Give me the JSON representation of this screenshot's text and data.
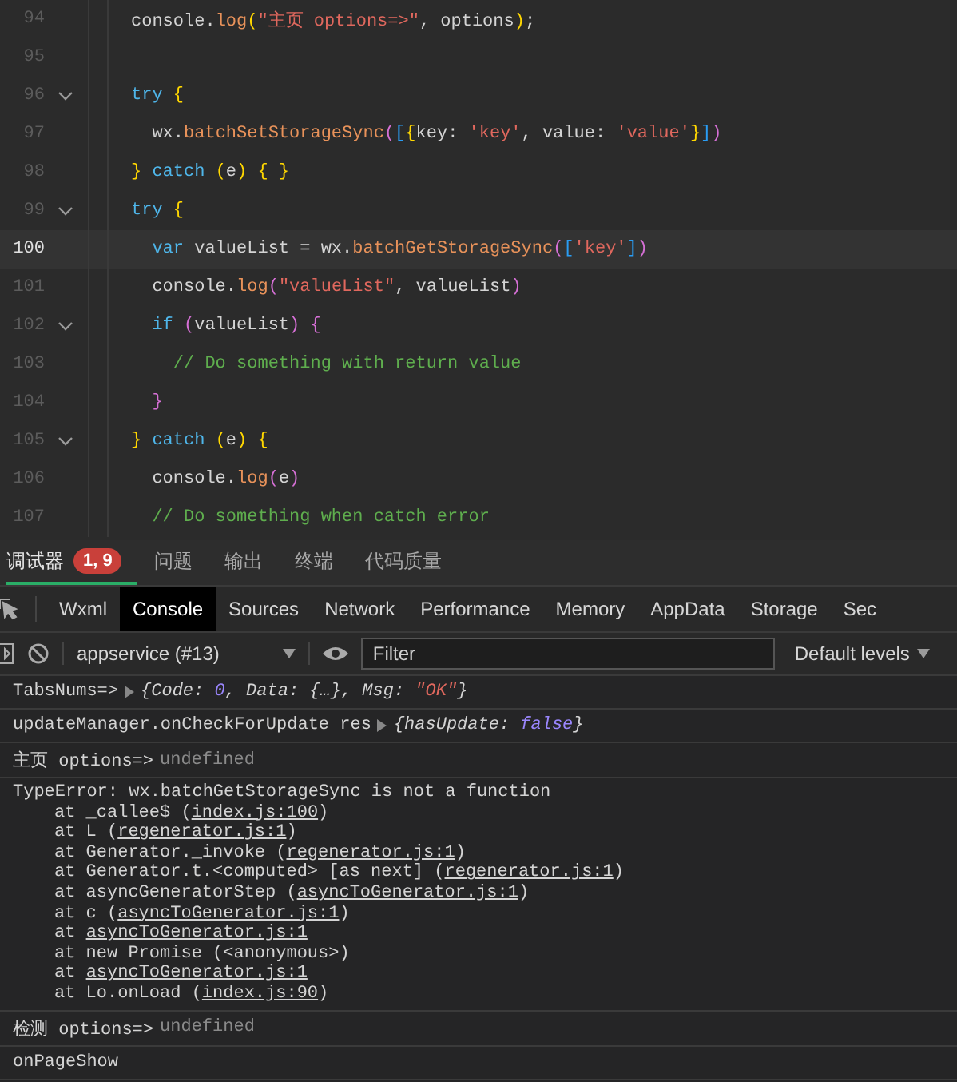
{
  "editor": {
    "lines": [
      {
        "number": "94",
        "fold": false,
        "current": false,
        "tokens": [
          {
            "text": "console.",
            "kind": "plain"
          },
          {
            "text": "log",
            "kind": "fn"
          },
          {
            "text": "(",
            "kind": "brace"
          },
          {
            "text": "\"主页 options=>\"",
            "kind": "str"
          },
          {
            "text": ", options",
            "kind": "plain"
          },
          {
            "text": ")",
            "kind": "brace"
          },
          {
            "text": ";",
            "kind": "plain"
          }
        ]
      },
      {
        "number": "95",
        "fold": false,
        "current": false
      },
      {
        "number": "96",
        "fold": true,
        "current": false,
        "tokens": [
          {
            "text": "try",
            "kind": "kw"
          },
          {
            "text": " {",
            "kind": "brace"
          }
        ]
      },
      {
        "number": "97",
        "fold": false,
        "current": false,
        "tokens": [
          {
            "text": "  wx.",
            "kind": "plain"
          },
          {
            "text": "batchSetStorageSync",
            "kind": "fn"
          },
          {
            "text": "(",
            "kind": "paren"
          },
          {
            "text": "[",
            "kind": "bracket"
          },
          {
            "text": "{",
            "kind": "brace"
          },
          {
            "text": "key: ",
            "kind": "plain"
          },
          {
            "text": "'key'",
            "kind": "str"
          },
          {
            "text": ", value: ",
            "kind": "plain"
          },
          {
            "text": "'value'",
            "kind": "str"
          },
          {
            "text": "}",
            "kind": "brace"
          },
          {
            "text": "]",
            "kind": "bracket"
          },
          {
            "text": ")",
            "kind": "paren"
          }
        ]
      },
      {
        "number": "98",
        "fold": false,
        "current": false,
        "tokens": [
          {
            "text": "} ",
            "kind": "brace"
          },
          {
            "text": "catch",
            "kind": "kw"
          },
          {
            "text": " (",
            "kind": "brace"
          },
          {
            "text": "e",
            "kind": "plain"
          },
          {
            "text": ") { }",
            "kind": "brace"
          }
        ]
      },
      {
        "number": "99",
        "fold": true,
        "current": false,
        "tokens": [
          {
            "text": "try",
            "kind": "kw"
          },
          {
            "text": " {",
            "kind": "brace"
          }
        ]
      },
      {
        "number": "100",
        "fold": false,
        "current": true,
        "tokens": [
          {
            "text": "  var",
            "kind": "kw"
          },
          {
            "text": " valueList = wx.",
            "kind": "plain"
          },
          {
            "text": "batchGetStorageSync",
            "kind": "fn"
          },
          {
            "text": "(",
            "kind": "paren"
          },
          {
            "text": "[",
            "kind": "bracket"
          },
          {
            "text": "'key'",
            "kind": "str"
          },
          {
            "text": "]",
            "kind": "bracket"
          },
          {
            "text": ")",
            "kind": "paren"
          }
        ]
      },
      {
        "number": "101",
        "fold": false,
        "current": false,
        "tokens": [
          {
            "text": "  console.",
            "kind": "plain"
          },
          {
            "text": "log",
            "kind": "fn"
          },
          {
            "text": "(",
            "kind": "paren"
          },
          {
            "text": "\"valueList\"",
            "kind": "str"
          },
          {
            "text": ", valueList",
            "kind": "plain"
          },
          {
            "text": ")",
            "kind": "paren"
          }
        ]
      },
      {
        "number": "102",
        "fold": true,
        "current": false,
        "tokens": [
          {
            "text": "  if",
            "kind": "kw"
          },
          {
            "text": " (",
            "kind": "paren"
          },
          {
            "text": "valueList",
            "kind": "plain"
          },
          {
            "text": ") {",
            "kind": "paren"
          }
        ]
      },
      {
        "number": "103",
        "fold": false,
        "current": false,
        "tokens": [
          {
            "text": "    // Do something with return value",
            "kind": "cmt"
          }
        ]
      },
      {
        "number": "104",
        "fold": false,
        "current": false,
        "tokens": [
          {
            "text": "  }",
            "kind": "paren"
          }
        ]
      },
      {
        "number": "105",
        "fold": true,
        "current": false,
        "tokens": [
          {
            "text": "} ",
            "kind": "brace"
          },
          {
            "text": "catch",
            "kind": "kw"
          },
          {
            "text": " (",
            "kind": "brace"
          },
          {
            "text": "e",
            "kind": "plain"
          },
          {
            "text": ") {",
            "kind": "brace"
          }
        ]
      },
      {
        "number": "106",
        "fold": false,
        "current": false,
        "tokens": [
          {
            "text": "  console.",
            "kind": "plain"
          },
          {
            "text": "log",
            "kind": "fn"
          },
          {
            "text": "(",
            "kind": "paren"
          },
          {
            "text": "e",
            "kind": "plain"
          },
          {
            "text": ")",
            "kind": "paren"
          }
        ]
      },
      {
        "number": "107",
        "fold": false,
        "current": false,
        "tokens": [
          {
            "text": "  // Do something when catch error",
            "kind": "cmt"
          }
        ]
      }
    ]
  },
  "panel_tabs": [
    {
      "label": "调试器",
      "selected": true,
      "badge": "1, 9"
    },
    {
      "label": "问题",
      "selected": false
    },
    {
      "label": "输出",
      "selected": false
    },
    {
      "label": "终端",
      "selected": false
    },
    {
      "label": "代码质量",
      "selected": false
    }
  ],
  "devtools_tabs": [
    {
      "label": "Wxml",
      "selected": false
    },
    {
      "label": "Console",
      "selected": true
    },
    {
      "label": "Sources",
      "selected": false
    },
    {
      "label": "Network",
      "selected": false
    },
    {
      "label": "Performance",
      "selected": false
    },
    {
      "label": "Memory",
      "selected": false
    },
    {
      "label": "AppData",
      "selected": false
    },
    {
      "label": "Storage",
      "selected": false
    },
    {
      "label": "Sec",
      "selected": false
    }
  ],
  "toolbar": {
    "context": "appservice (#13)",
    "filter": {
      "placeholder": "Filter"
    },
    "levels": "Default levels"
  },
  "messages": [
    {
      "kind": "object",
      "label": "TabsNums=>",
      "preview": [
        {
          "text": "{Code: ",
          "kind": "plain"
        },
        {
          "text": "0",
          "kind": "num"
        },
        {
          "text": ", Data: {…}, Msg: ",
          "kind": "plain"
        },
        {
          "text": "\"OK\"",
          "kind": "str"
        },
        {
          "text": "}",
          "kind": "plain"
        }
      ]
    },
    {
      "kind": "object",
      "label": "updateManager.onCheckForUpdate res",
      "preview": [
        {
          "text": "{hasUpdate: ",
          "kind": "plain"
        },
        {
          "text": "false",
          "kind": "num"
        },
        {
          "text": "}",
          "kind": "plain"
        }
      ]
    },
    {
      "kind": "log",
      "label": "主页 options=>",
      "value": "undefined"
    },
    {
      "kind": "error",
      "message": "TypeError: wx.batchGetStorageSync is not a function",
      "stack": [
        {
          "text": "at _callee$ (",
          "link": "index.js:100",
          "end": ")"
        },
        {
          "text": "at L (",
          "link": "regenerator.js:1",
          "end": ")"
        },
        {
          "text": "at Generator._invoke (",
          "link": "regenerator.js:1",
          "end": ")"
        },
        {
          "text": "at Generator.t.<computed> [as next] (",
          "link": "regenerator.js:1",
          "end": ")"
        },
        {
          "text": "at asyncGeneratorStep (",
          "link": "asyncToGenerator.js:1",
          "end": ")"
        },
        {
          "text": "at c (",
          "link": "asyncToGenerator.js:1",
          "end": ")"
        },
        {
          "text": "at ",
          "link": "asyncToGenerator.js:1"
        },
        {
          "text": "at new Promise (<anonymous>)"
        },
        {
          "text": "at ",
          "link": "asyncToGenerator.js:1"
        },
        {
          "text": "at Lo.onLoad (",
          "link": "index.js:90",
          "end": ")"
        }
      ]
    },
    {
      "kind": "log",
      "label": "检测 options=>",
      "value": "undefined"
    },
    {
      "kind": "plain",
      "label": "onPageShow"
    }
  ]
}
